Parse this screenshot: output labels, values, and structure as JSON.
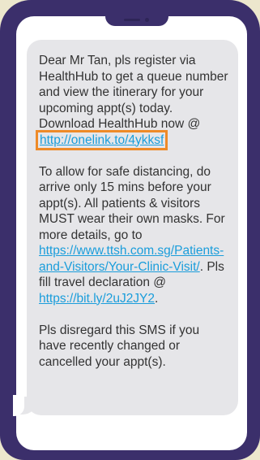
{
  "sms": {
    "p1_text": "Dear Mr Tan, pls register via HealthHub to get a queue number and view the itinerary for your upcoming appt(s) today. Download HealthHub now @ ",
    "p1_link": "http://onelink.to/4ykksf",
    "p2_text_a": "To allow for safe distancing, do arrive only 15 mins before your appt(s). All patients & visitors MUST wear their own masks. For more details, go to ",
    "p2_link_1": "https://www.ttsh.com.sg/Patients-and-Visitors/Your-Clinic-Visit/",
    "p2_text_b": ". Pls fill travel declaration @ ",
    "p2_link_2": "https://bit.ly/2uJ2JY2",
    "p2_text_c": ".",
    "p3_text": "Pls disregard this SMS if you have recently changed or cancelled your appt(s)."
  },
  "colors": {
    "phone_frame": "#3b2f6b",
    "bubble": "#e6e6e9",
    "link": "#1a9ddb",
    "highlight_box": "#ee8a28",
    "background": "#ece7cd"
  }
}
